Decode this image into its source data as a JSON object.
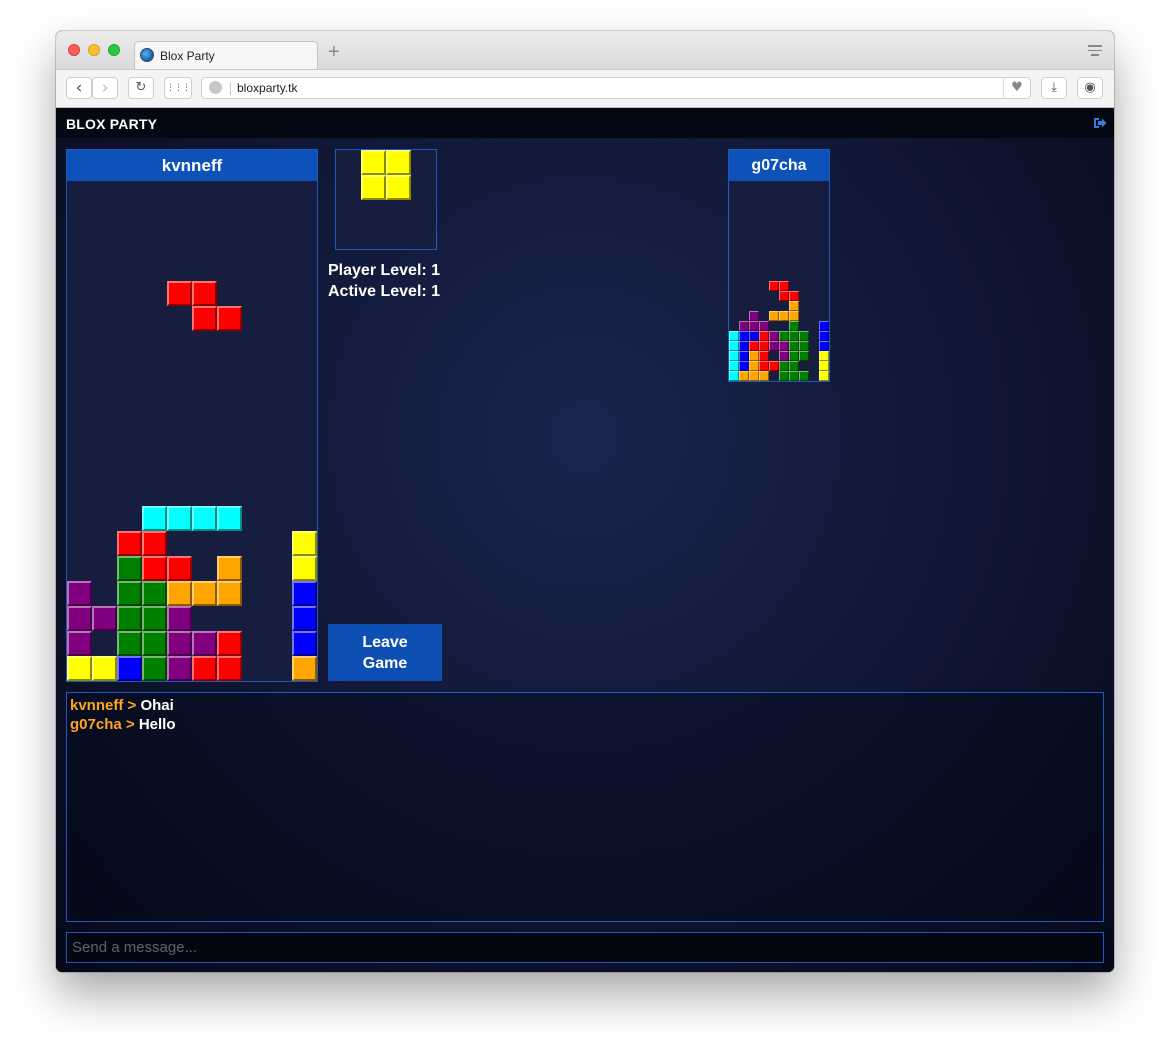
{
  "browser": {
    "tab_title": "Blox Party",
    "url": "bloxparty.tk",
    "new_tab_label": "+",
    "back_label": "‹",
    "forward_label": "›",
    "reload_label": "↻",
    "grid_label": "⋮⋮⋮",
    "heart_label": "♥",
    "download_label": "⤓",
    "profile_label": "◉"
  },
  "app": {
    "brand": "BLOX PARTY",
    "logout_icon": "sign-out-icon"
  },
  "player_board": {
    "name": "kvnneff",
    "columns": 10,
    "rows": 20,
    "active_piece": "red Z",
    "grid": [
      "..........",
      "..........",
      "..........",
      "..........",
      "....RR....",
      ".....RR...",
      "..........",
      "..........",
      "..........",
      "..........",
      "..........",
      "..........",
      "..........",
      "...CCCC...",
      "..RR.....YY",
      "..GRR.O..YY",
      "P.GGOOO..BB",
      "PPGGP....BC",
      "P.GGPPR..BC",
      "YYBGPRR..OC"
    ]
  },
  "next_piece": {
    "shape": "O",
    "color": "yellow",
    "grid": [
      "YY",
      "YY"
    ]
  },
  "stats": {
    "player_level": "Player Level: 1",
    "active_level": "Active Level: 1"
  },
  "leave_button": {
    "line1": "Leave",
    "line2": "Game"
  },
  "opponent_board": {
    "name": "g07cha",
    "columns": 10,
    "rows": 20,
    "grid": [
      "..........",
      "..........",
      "..........",
      "..........",
      "..........",
      "..........",
      "..........",
      "..........",
      "..........",
      "..........",
      "....RR....",
      ".....RR...",
      "......O...",
      "..P.OOO...",
      ".PPP..G..B",
      "CBBRPGGG.B",
      "CBRRPPGG.BB",
      "CBOR.PGG.YY",
      "CBORRGG..YY",
      "COOO.GGG.YY"
    ]
  },
  "chat": {
    "messages": [
      {
        "user": "kvnneff",
        "sep": ">",
        "text": "Ohai"
      },
      {
        "user": "g07cha",
        "sep": ">",
        "text": "Hello"
      }
    ],
    "input_placeholder": "Send a message..."
  },
  "colors": {
    "Y": "#ffff00",
    "R": "#ff0000",
    "C": "#00ffff",
    "G": "#008000",
    "O": "#ffa500",
    "P": "#800080",
    "B": "#0000ff",
    "accent": "#0d52b8",
    "chat_user": "#ffa51f"
  }
}
